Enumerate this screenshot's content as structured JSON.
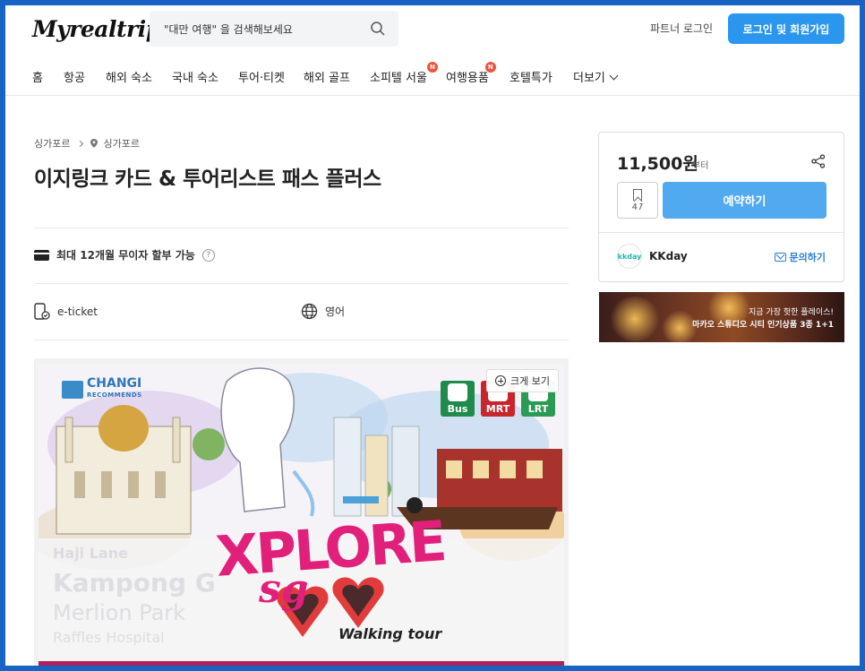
{
  "header": {
    "logo": "Myrealtrip",
    "search_placeholder": "\"대만 여행\" 을 검색해보세요",
    "partner_login": "파트너 로그인",
    "login_signup": "로그인 및 회원가입"
  },
  "nav": {
    "items": [
      {
        "label": "홈"
      },
      {
        "label": "항공"
      },
      {
        "label": "해외 숙소"
      },
      {
        "label": "국내 숙소"
      },
      {
        "label": "투어·티켓"
      },
      {
        "label": "해외 골프"
      },
      {
        "label": "소피텔 서울",
        "badge": "N"
      },
      {
        "label": "여행용품",
        "badge": "N"
      },
      {
        "label": "호텔특가"
      },
      {
        "label": "더보기"
      }
    ]
  },
  "breadcrumb": {
    "country": "싱가포르",
    "city": "싱가포르"
  },
  "product": {
    "title": "이지링크 카드 & 투어리스트 패스 플러스",
    "installment": "최대 12개월 무이자 할부 가능",
    "ticket_type": "e-ticket",
    "language": "영어"
  },
  "gallery": {
    "zoom_label": "크게 보기",
    "image": {
      "brand_top": "CHANGI",
      "brand_bottom": "RECOMMENDS",
      "transit": [
        {
          "label": "Bus",
          "color": "#1f8a4c"
        },
        {
          "label": "MRT",
          "color": "#c8252c"
        },
        {
          "label": "LRT",
          "color": "#2a9a54"
        }
      ],
      "streets": [
        "Haji Lane",
        "Kampong G",
        "Merlion Park",
        "Raffles Hospital"
      ],
      "headline": "XPLORE",
      "headline_sub": "sg",
      "tagline": "Walking tour"
    }
  },
  "booking": {
    "price": "11,500원",
    "price_suffix": "부터",
    "wishlist_count": "47",
    "reserve_label": "예약하기",
    "seller_logo": "kkday",
    "seller_name": "KKday",
    "inquire_label": "문의하기"
  },
  "banner": {
    "line1": "지금 가장 핫한 플레이스!",
    "line2": "마카오 스튜디오 시티 인기상품 3종 1+1"
  },
  "colors": {
    "accent": "#2b96ed",
    "reserve": "#51a9f0",
    "badge": "#f0533d",
    "frame": "#1764c4",
    "headline": "#e0207a"
  }
}
